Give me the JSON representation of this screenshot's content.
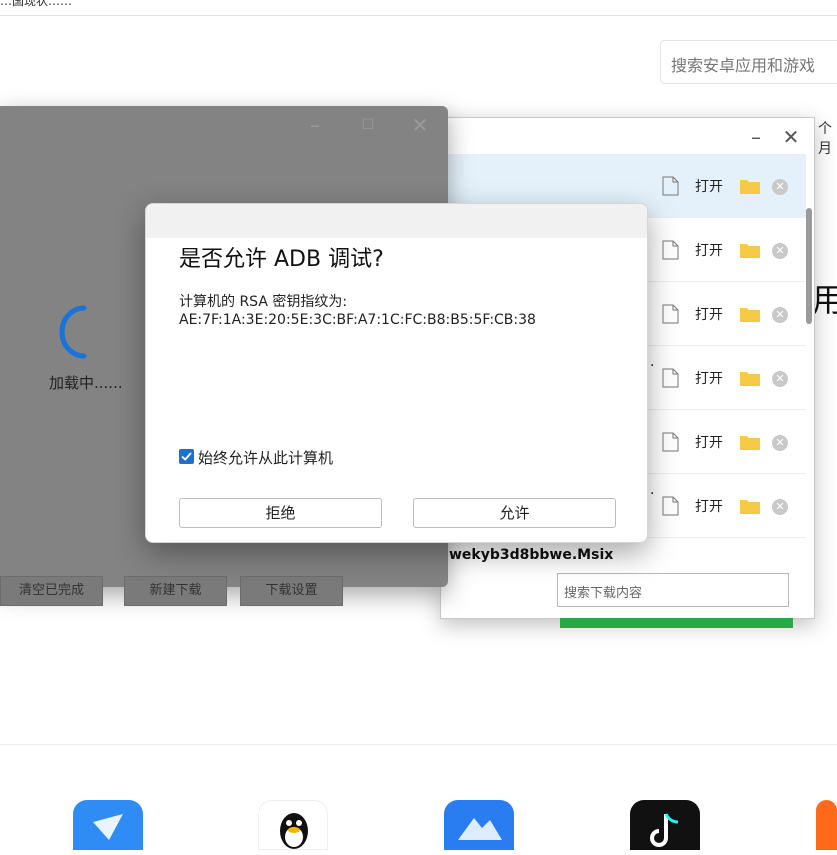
{
  "top": {
    "title_fragment": "…国现状……"
  },
  "search_apps": {
    "placeholder": "搜索安卓应用和游戏"
  },
  "right_fragments": {
    "small": "个月",
    "large": "用"
  },
  "download_window": {
    "rows": [
      {
        "open_label": "打开",
        "selected": true
      },
      {
        "open_label": "打开",
        "selected": false
      },
      {
        "open_label": "打开",
        "selected": false
      },
      {
        "open_label": "打开",
        "selected": false
      },
      {
        "open_label": "打开",
        "selected": false
      },
      {
        "open_label": "打开",
        "selected": false
      }
    ],
    "partial_filename": "wekyb3d8bbwe.Msix",
    "search_placeholder": "搜索下载内容"
  },
  "loading_window": {
    "loading_text": "加载中......",
    "buttons": [
      "清空已完成",
      "新建下载",
      "下载设置"
    ]
  },
  "adb_dialog": {
    "title": "是否允许 ADB 调试?",
    "line1": "计算机的 RSA 密钥指纹为:",
    "fingerprint": "AE:7F:1A:3E:20:5E:3C:BF:A7:1C:FC:B8:B5:5F:CB:38",
    "always_allow_label": "始终允许从此计算机",
    "always_allow_checked": true,
    "deny_label": "拒绝",
    "allow_label": "允许"
  },
  "bottom_apps": [
    {
      "icon": "feishu-icon",
      "color": "#2f8cf5"
    },
    {
      "icon": "qq-icon",
      "color": "#ffffff"
    },
    {
      "icon": "mountain-app-icon",
      "color": "#2a7df0"
    },
    {
      "icon": "tiktok-icon",
      "color": "#111111"
    },
    {
      "icon": "orange-app-icon",
      "color": "#ff6a1a"
    }
  ]
}
